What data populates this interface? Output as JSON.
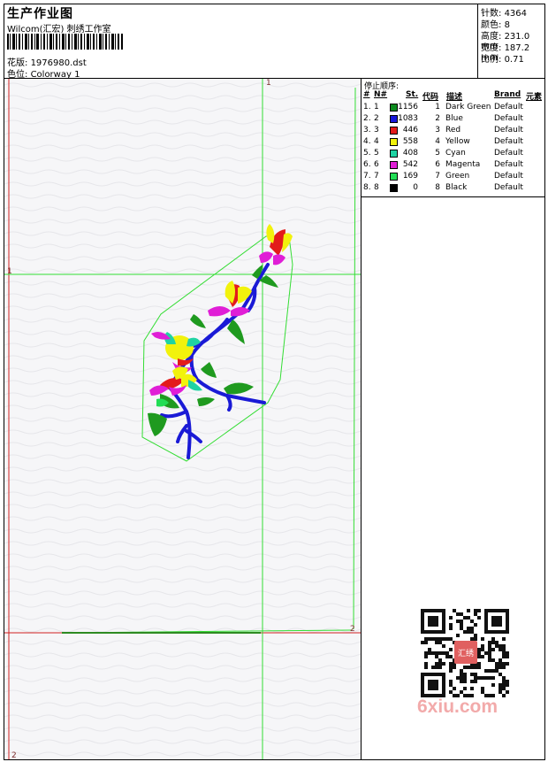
{
  "header": {
    "title": "生产作业图",
    "subtitle": "Wilcom(汇宏) 刺绣工作室",
    "design_label": "花版:",
    "design_value": "1976980.dst",
    "colorway_label": "色位:",
    "colorway_value": "Colorway 1"
  },
  "stats": [
    {
      "label": "针数:",
      "value": "4364"
    },
    {
      "label": "颜色:",
      "value": "8"
    },
    {
      "label": "高度:",
      "value": "231.0 mm"
    },
    {
      "label": "宽度:",
      "value": "187.2 mm"
    },
    {
      "label": "比例:",
      "value": "0.71"
    }
  ],
  "stop_sequence": {
    "title": "停止顺序:",
    "columns": [
      "#",
      "N#",
      "St.",
      "代码",
      "描述",
      "Brand",
      "元素"
    ],
    "rows": [
      {
        "num": "1.",
        "n": "1",
        "color": "#0c8a1e",
        "stitches": "1156",
        "code": "1",
        "desc": "Dark Green",
        "brand": "Default"
      },
      {
        "num": "2.",
        "n": "2",
        "color": "#1717d8",
        "stitches": "1083",
        "code": "2",
        "desc": "Blue",
        "brand": "Default"
      },
      {
        "num": "3.",
        "n": "3",
        "color": "#e31b1b",
        "stitches": "446",
        "code": "3",
        "desc": "Red",
        "brand": "Default"
      },
      {
        "num": "4.",
        "n": "4",
        "color": "#f2f20c",
        "stitches": "558",
        "code": "4",
        "desc": "Yellow",
        "brand": "Default"
      },
      {
        "num": "5.",
        "n": "5",
        "color": "#1fd3a3",
        "stitches": "408",
        "code": "5",
        "desc": "Cyan",
        "brand": "Default"
      },
      {
        "num": "6.",
        "n": "6",
        "color": "#e01ed6",
        "stitches": "542",
        "code": "6",
        "desc": "Magenta",
        "brand": "Default"
      },
      {
        "num": "7.",
        "n": "7",
        "color": "#22dd55",
        "stitches": "169",
        "code": "7",
        "desc": "Green",
        "brand": "Default"
      },
      {
        "num": "8.",
        "n": "8",
        "color": "#000000",
        "stitches": "0",
        "code": "8",
        "desc": "Black",
        "brand": "Default"
      }
    ]
  },
  "canvas": {
    "markers": {
      "top": "1",
      "left": "1",
      "right": "2",
      "bottom": "2"
    },
    "colors": {
      "guide_green": "#33dd33",
      "guide_red": "#d02020",
      "background": "#f6f6f8"
    }
  },
  "watermark": {
    "text": "6xiu.com",
    "badge_text": "汇绣"
  }
}
